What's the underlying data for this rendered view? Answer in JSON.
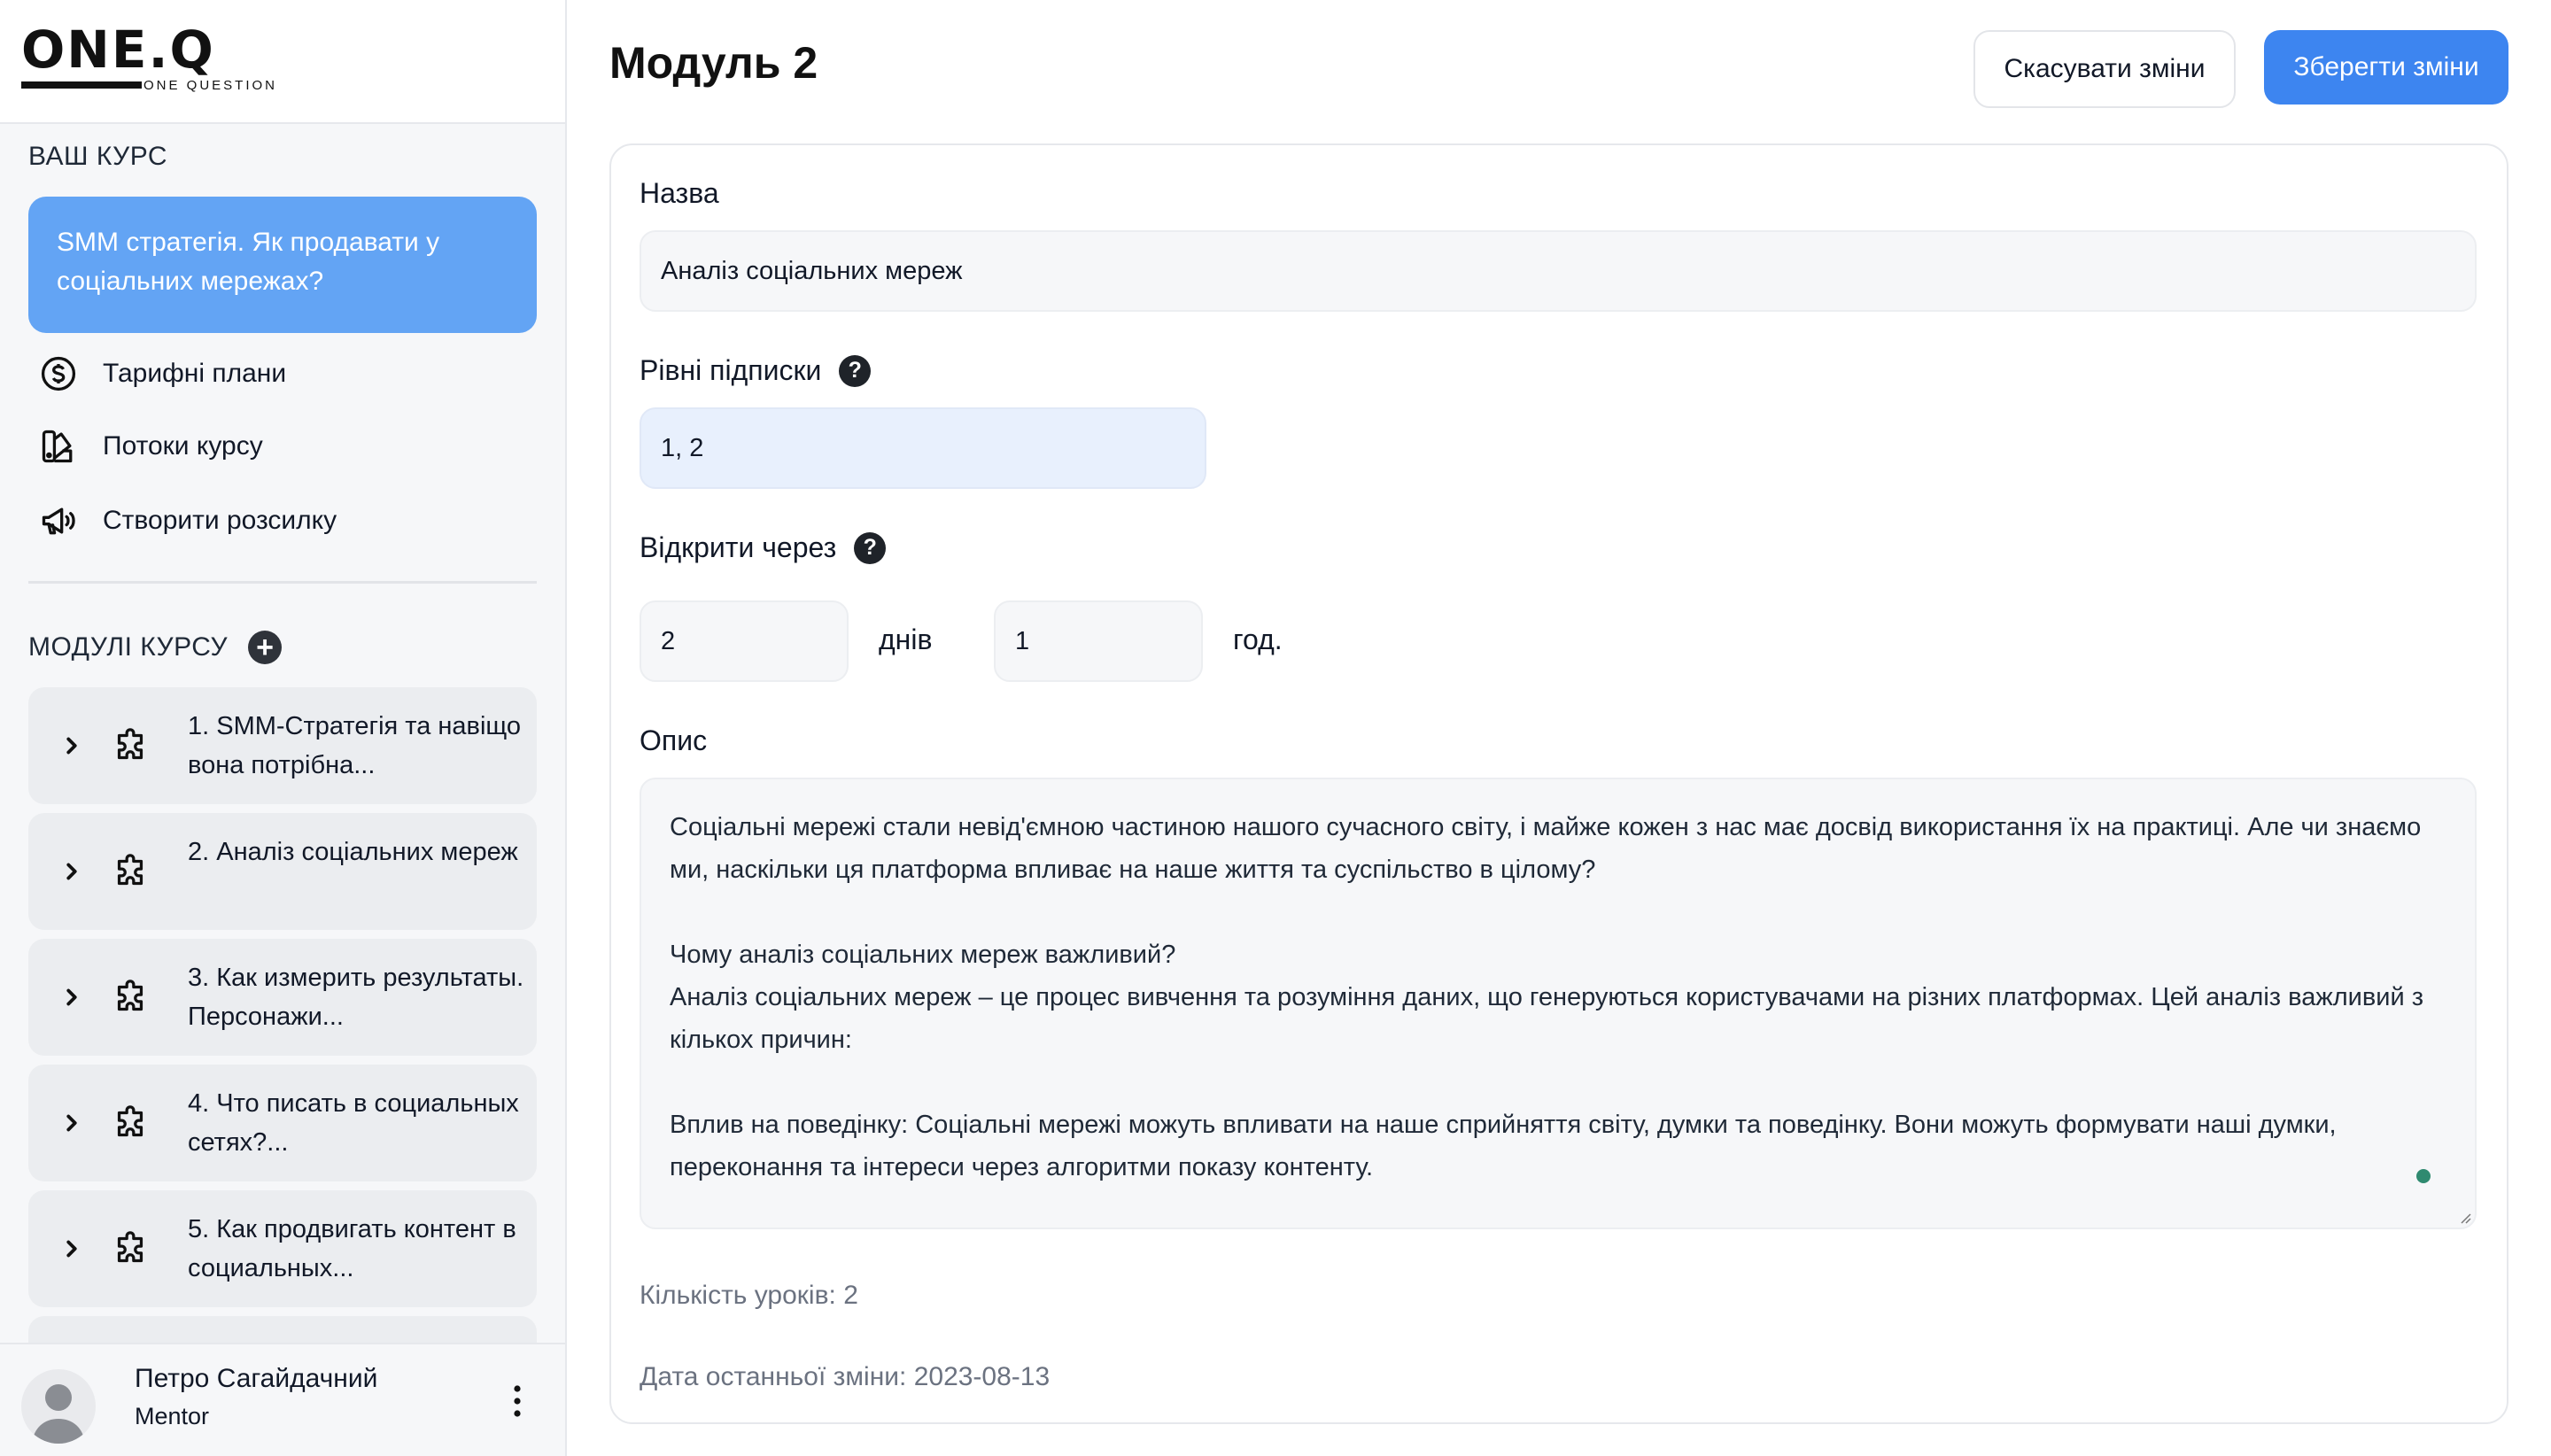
{
  "brand": {
    "logo": "ONE.Q",
    "tagline": "ONE QUESTION"
  },
  "sidebar": {
    "course_section_label": "ВАШ КУРС",
    "course_title": "SMM стратегія. Як продавати у соціальних мережах?",
    "nav": [
      {
        "label": "Тарифні плани",
        "icon": "dollar-circle-icon"
      },
      {
        "label": "Потоки курсу",
        "icon": "swatches-icon"
      },
      {
        "label": "Створити розсилку",
        "icon": "megaphone-icon"
      }
    ],
    "modules_section_label": "МОДУЛІ КУРСУ",
    "modules": [
      {
        "title": "1. SMM-Стратегія та навіщо вона потрібна..."
      },
      {
        "title": "2. Аналіз соціальних мереж"
      },
      {
        "title": "3. Как измерить результаты. Персонажи..."
      },
      {
        "title": "4. Что писать в социальных сетях?..."
      },
      {
        "title": "5. Как продвигать контент в социальных..."
      }
    ],
    "user": {
      "name": "Петро Сагайдачний",
      "role": "Mentor"
    }
  },
  "header": {
    "title": "Модуль 2",
    "cancel_label": "Скасувати зміни",
    "save_label": "Зберегти зміни"
  },
  "form": {
    "name_label": "Назва",
    "name_value": "Аналіз соціальних мереж",
    "levels_label": "Рівні підписки",
    "levels_value": "1, 2",
    "open_label": "Відкрити через",
    "open_days_value": "2",
    "days_unit": "днів",
    "open_hours_value": "1",
    "hours_unit": "год.",
    "description_label": "Опис",
    "description_lines": [
      "Соціальні мережі стали невід'ємною частиною нашого сучасного світу, і майже кожен з нас має досвід використання їх на практиці. Але чи знаємо ми, наскільки ця платформа впливає на наше життя та суспільство в цілому?",
      "Чому аналіз соціальних мереж важливий?",
      "Аналіз соціальних мереж – це процес вивчення та розуміння даних, що генеруються користувачами на різних платформах. Цей аналіз важливий з кількох причин:",
      "Вплив на поведінку: Соціальні мережі можуть впливати на наше сприйняття світу, думки та поведінку. Вони можуть формувати наші думки, переконання та інтереси через алгоритми показу контенту."
    ],
    "lessons_count": "Кількість уроків: 2",
    "last_modified": "Дата останньої зміни: 2023-08-13"
  },
  "colors": {
    "accent": "#3d85f0",
    "course_card": "#63a4f4",
    "levels_input_bg": "#e8f0fd",
    "status_dot": "#2f8a70"
  }
}
